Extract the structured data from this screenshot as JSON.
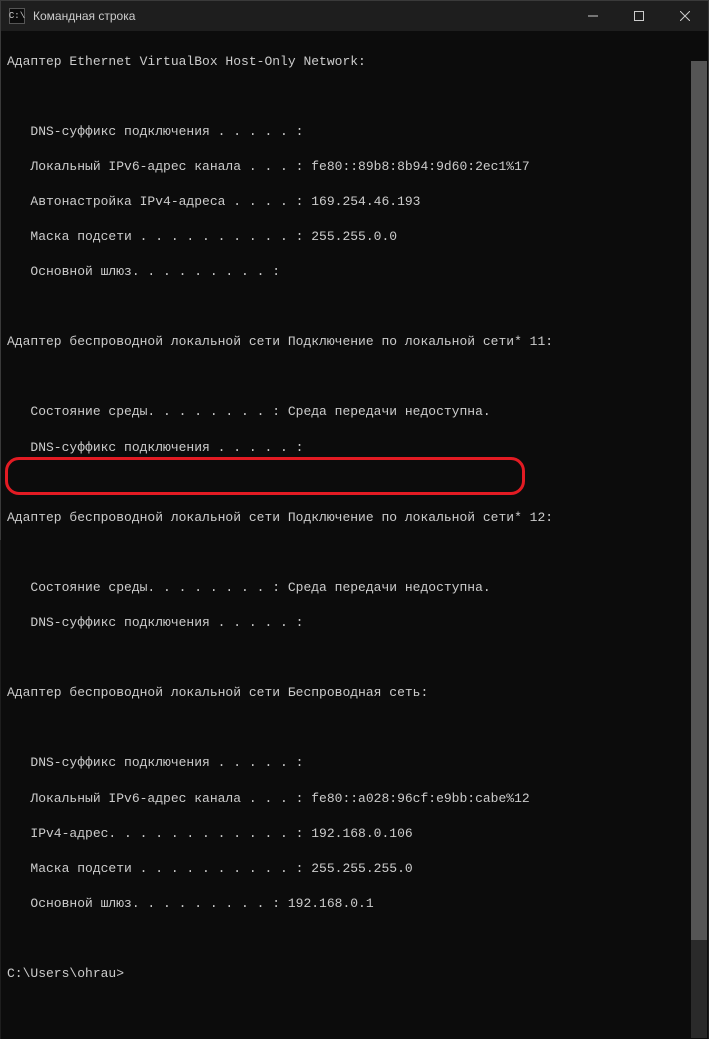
{
  "window": {
    "title": "Командная строка"
  },
  "terminal": {
    "sections": [
      {
        "header": "Адаптер Ethernet VirtualBox Host-Only Network:",
        "lines": [
          "   DNS-суффикс подключения . . . . . :",
          "   Локальный IPv6-адрес канала . . . : fe80::89b8:8b94:9d60:2ec1%17",
          "   Автонастройка IPv4-адреса . . . . : 169.254.46.193",
          "   Маска подсети . . . . . . . . . . : 255.255.0.0",
          "   Основной шлюз. . . . . . . . . :"
        ]
      },
      {
        "header": "Адаптер беспроводной локальной сети Подключение по локальной сети* 11:",
        "lines": [
          "   Состояние среды. . . . . . . . : Среда передачи недоступна.",
          "   DNS-суффикс подключения . . . . . :"
        ]
      },
      {
        "header": "Адаптер беспроводной локальной сети Подключение по локальной сети* 12:",
        "lines": [
          "   Состояние среды. . . . . . . . : Среда передачи недоступна.",
          "   DNS-суффикс подключения . . . . . :"
        ]
      },
      {
        "header": "Адаптер беспроводной локальной сети Беспроводная сеть:",
        "lines": [
          "   DNS-суффикс подключения . . . . . :",
          "   Локальный IPv6-адрес канала . . . : fe80::a028:96cf:e9bb:cabe%12",
          "   IPv4-адрес. . . . . . . . . . . . : 192.168.0.106",
          "   Маска подсети . . . . . . . . . . : 255.255.255.0",
          "   Основной шлюз. . . . . . . . . : 192.168.0.1"
        ]
      }
    ],
    "prompt": "C:\\Users\\ohrau>"
  }
}
